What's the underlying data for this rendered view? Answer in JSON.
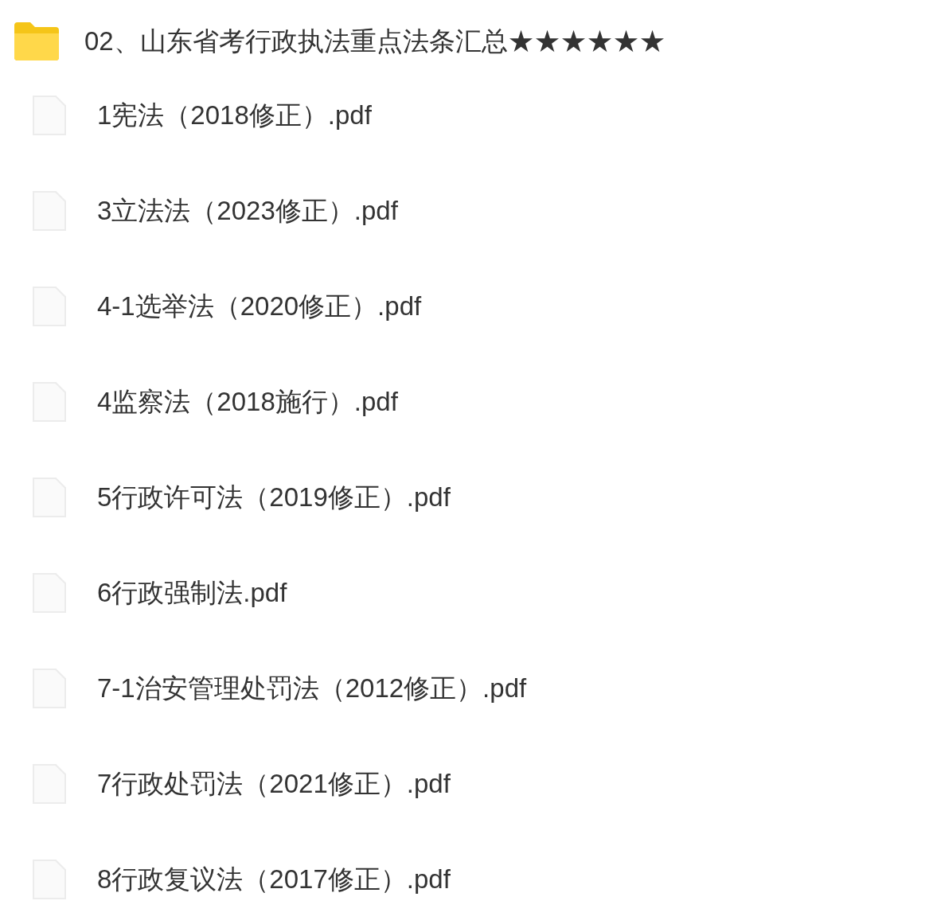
{
  "folder": {
    "name": "02、山东省考行政执法重点法条汇总★★★★★★"
  },
  "files": [
    {
      "name": "1宪法（2018修正）.pdf"
    },
    {
      "name": "3立法法（2023修正）.pdf"
    },
    {
      "name": "4-1选举法（2020修正）.pdf"
    },
    {
      "name": "4监察法（2018施行）.pdf"
    },
    {
      "name": "5行政许可法（2019修正）.pdf"
    },
    {
      "name": "6行政强制法.pdf"
    },
    {
      "name": "7-1治安管理处罚法（2012修正）.pdf"
    },
    {
      "name": "7行政处罚法（2021修正）.pdf"
    },
    {
      "name": "8行政复议法（2017修正）.pdf"
    }
  ]
}
